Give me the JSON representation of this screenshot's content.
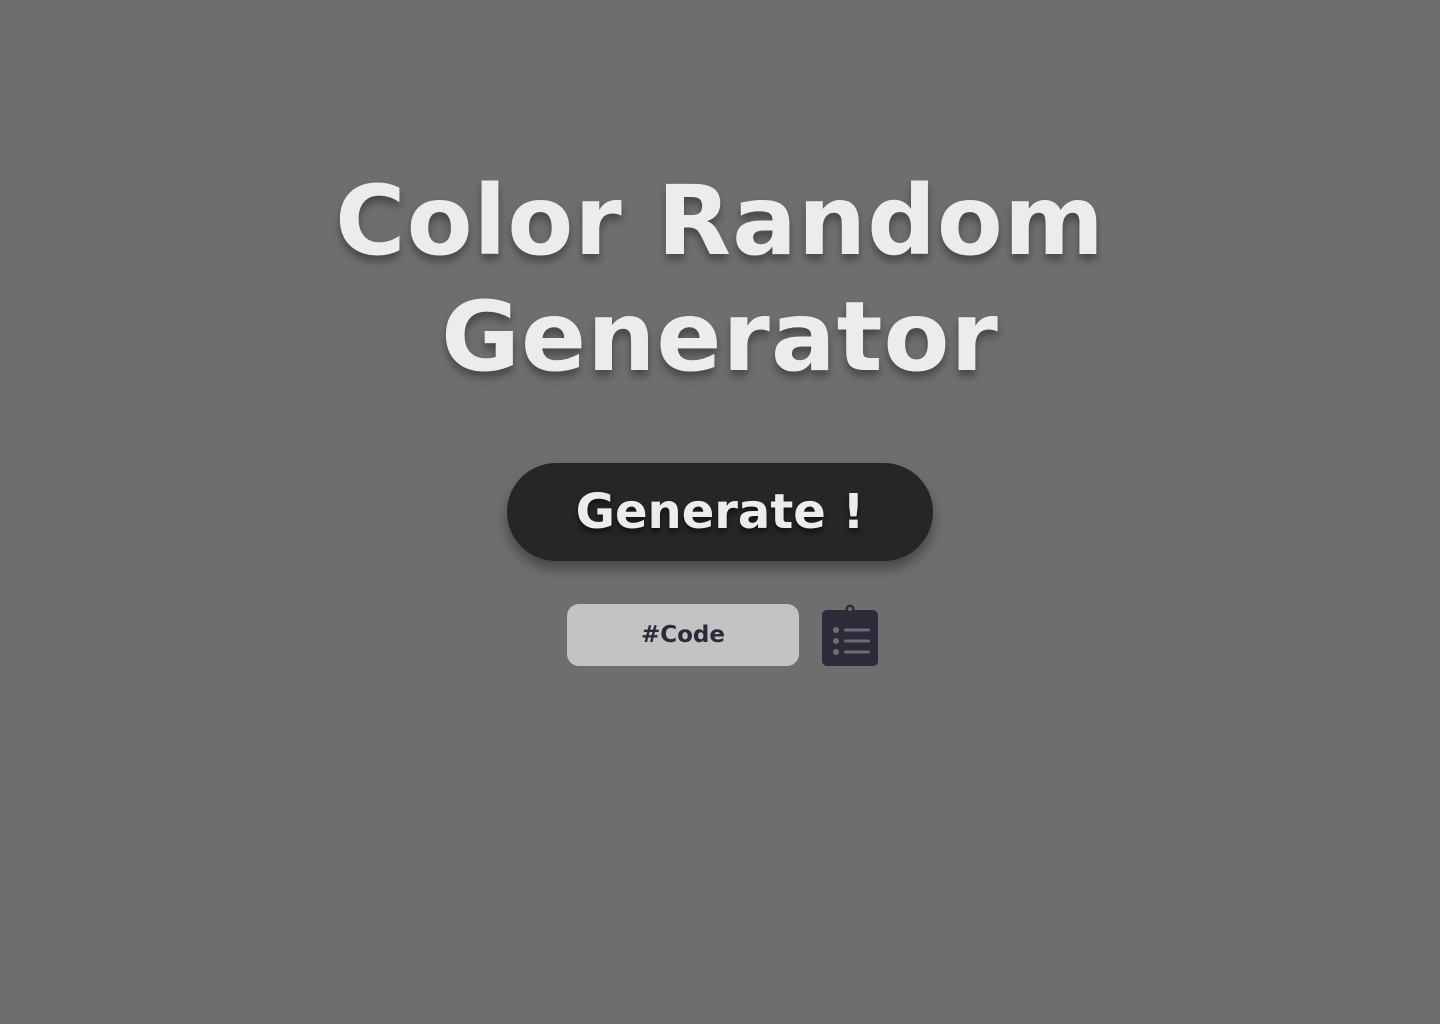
{
  "page": {
    "background_color": "#6e6e6e"
  },
  "header": {
    "title_line1": "Color Random",
    "title_line2": "Generator"
  },
  "controls": {
    "generate_label": "Generate !",
    "code_placeholder": "#Code",
    "code_value": "",
    "copy_icon": "clipboard-list-icon"
  },
  "colors": {
    "title_text": "#ececec",
    "button_bg": "#272625",
    "input_bg": "#c3c3c3",
    "input_text": "#2b2b3a",
    "icon": "#2b2b3a"
  }
}
